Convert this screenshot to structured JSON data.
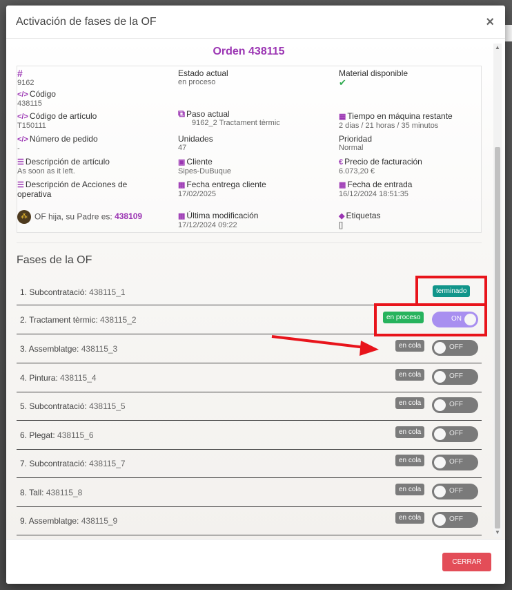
{
  "modal": {
    "title": "Activación de fases de la OF",
    "close_icon": "close-icon",
    "order_title": "Orden 438115"
  },
  "info": {
    "id_label": "#",
    "id_value": "9162",
    "codigo_label": "Código",
    "codigo_value": "438115",
    "estado_label": "Estado actual",
    "estado_value": "en proceso",
    "material_label": "Material disponible",
    "material_icon": "check-icon",
    "codigo_articulo_label": "Código de artículo",
    "codigo_articulo_value": "T150111",
    "paso_label": "Paso actual",
    "paso_value": "9162_2 Tractament tèrmic",
    "tiempo_label": "Tiempo en máquina restante",
    "tiempo_value": "2 dias / 21 horas / 35 minutos",
    "pedido_label": "Número de pedido",
    "pedido_value": "-",
    "unidades_label": "Unidades",
    "unidades_value": "47",
    "prioridad_label": "Prioridad",
    "prioridad_value": "Normal",
    "desc_articulo_label": "Descripción de artículo",
    "desc_articulo_value": "As soon as it left.",
    "cliente_label": "Cliente",
    "cliente_value": "Sipes-DuBuque",
    "precio_label": "Precio de facturación",
    "precio_value": "6.073,20 €",
    "desc_acciones_label": "Descripción de Acciones de operativa",
    "fecha_entrega_label": "Fecha entrega cliente",
    "fecha_entrega_value": "17/02/2025",
    "fecha_entrada_label": "Fecha de entrada",
    "fecha_entrada_value": "16/12/2024 18:51:35",
    "parent_text": "OF hija, su Padre es:",
    "parent_value": "438109",
    "modificacion_label": "Última modificación",
    "modificacion_value": "17/12/2024 09:22",
    "etiquetas_label": "Etiquetas",
    "etiquetas_value": "[]"
  },
  "phases": {
    "title": "Fases de la OF",
    "items": [
      {
        "name": "1. Subcontratació:",
        "code": "438115_1",
        "status": "terminado",
        "toggle": null
      },
      {
        "name": "2. Tractament tèrmic:",
        "code": "438115_2",
        "status": "en proceso",
        "toggle": "ON"
      },
      {
        "name": "3. Assemblatge:",
        "code": "438115_3",
        "status": "en cola",
        "toggle": "OFF"
      },
      {
        "name": "4. Pintura:",
        "code": "438115_4",
        "status": "en cola",
        "toggle": "OFF"
      },
      {
        "name": "5. Subcontratació:",
        "code": "438115_5",
        "status": "en cola",
        "toggle": "OFF"
      },
      {
        "name": "6. Plegat:",
        "code": "438115_6",
        "status": "en cola",
        "toggle": "OFF"
      },
      {
        "name": "7. Subcontratació:",
        "code": "438115_7",
        "status": "en cola",
        "toggle": "OFF"
      },
      {
        "name": "8. Tall:",
        "code": "438115_8",
        "status": "en cola",
        "toggle": "OFF"
      },
      {
        "name": "9. Assemblatge:",
        "code": "438115_9",
        "status": "en cola",
        "toggle": "OFF"
      }
    ]
  },
  "footer": {
    "close_label": "CERRAR"
  },
  "colors": {
    "accent": "#9b35b3",
    "terminado": "#11958a",
    "en_proceso": "#27b35d",
    "en_cola": "#7b7b7b",
    "toggle_on": "#a88ff0",
    "close_button": "#e34d58",
    "annotation": "#e8141b"
  }
}
